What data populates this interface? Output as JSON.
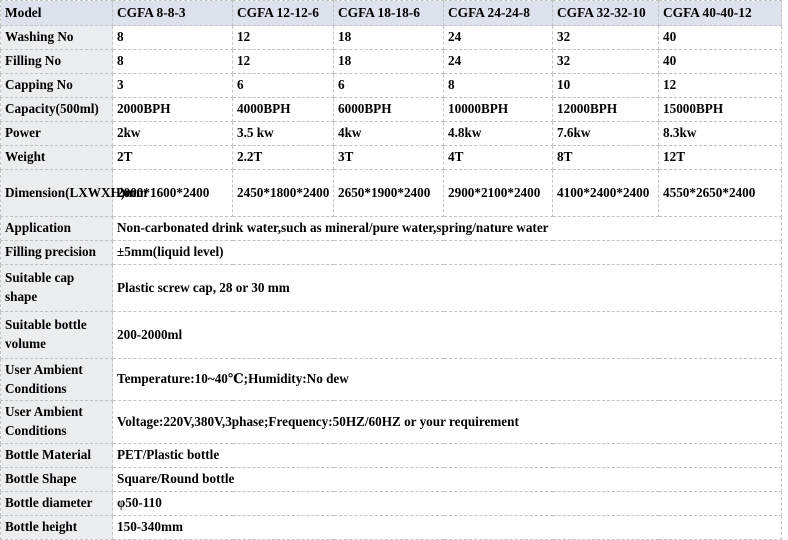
{
  "table": {
    "headers": [
      "Model",
      "CGFA 8-8-3",
      "CGFA 12-12-6",
      "CGFA 18-18-6",
      "CGFA 24-24-8",
      "CGFA 32-32-10",
      "CGFA 40-40-12"
    ],
    "rows": [
      {
        "label": "Washing No",
        "type": "multi",
        "values": [
          "8",
          "12",
          "18",
          "24",
          "32",
          "40"
        ]
      },
      {
        "label": "Filling No",
        "type": "multi",
        "values": [
          "8",
          "12",
          "18",
          "24",
          "32",
          "40"
        ]
      },
      {
        "label": "Capping No",
        "type": "multi",
        "values": [
          "3",
          "6",
          "6",
          "8",
          "10",
          "12"
        ]
      },
      {
        "label": "Capacity(500ml)",
        "type": "multi",
        "values": [
          "2000BPH",
          "4000BPH",
          "6000BPH",
          "10000BPH",
          "12000BPH",
          "15000BPH"
        ]
      },
      {
        "label": "Power",
        "type": "multi",
        "values": [
          "2kw",
          "3.5 kw",
          "4kw",
          "4.8kw",
          "7.6kw",
          "8.3kw"
        ]
      },
      {
        "label": "Weight",
        "type": "multi",
        "values": [
          "2T",
          "2.2T",
          "3T",
          "4T",
          "8T",
          "12T"
        ]
      },
      {
        "label": "Dimension(LXWXH)mm",
        "type": "multi",
        "values": [
          "2000*1600*2400",
          "2450*1800*2400",
          "2650*1900*2400",
          "2900*2100*2400",
          "4100*2400*2400",
          "4550*2650*2400"
        ]
      },
      {
        "label": "Application",
        "type": "span",
        "value": "Non-carbonated drink water,such as mineral/pure water,spring/nature water"
      },
      {
        "label": "Filling precision",
        "type": "span",
        "value": "±5mm(liquid level)"
      },
      {
        "label": "Suitable cap shape",
        "type": "span",
        "value": "Plastic screw cap, 28 or 30 mm"
      },
      {
        "label": "Suitable bottle volume",
        "type": "span",
        "value": "200-2000ml"
      },
      {
        "label": "User Ambient Conditions",
        "type": "span",
        "value": "Temperature:10~40℃;Humidity:No dew"
      },
      {
        "label": "User Ambient Conditions",
        "type": "span",
        "value": "Voltage:220V,380V,3phase;Frequency:50HZ/60HZ or your requirement"
      },
      {
        "label": "Bottle Material",
        "type": "span",
        "value": "PET/Plastic bottle"
      },
      {
        "label": "Bottle Shape",
        "type": "span",
        "value": "Square/Round bottle"
      },
      {
        "label": "Bottle diameter",
        "type": "span",
        "value": "φ50-110"
      },
      {
        "label": "Bottle height",
        "type": "span",
        "value": "150-340mm"
      }
    ]
  },
  "colors": {
    "header_background": "#dde2ec",
    "label_background": "#ecedf1",
    "border": "#c3c3c3",
    "text": "#000000",
    "page_background": "#ffffff"
  }
}
